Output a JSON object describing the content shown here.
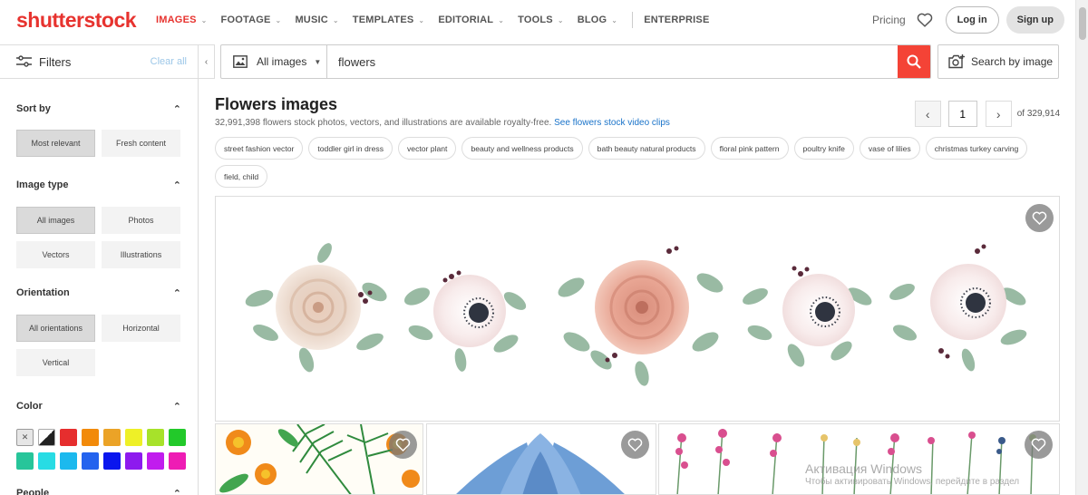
{
  "logo": "shutterstock",
  "nav": {
    "items": [
      {
        "label": "IMAGES",
        "has_menu": true,
        "active": true
      },
      {
        "label": "FOOTAGE",
        "has_menu": true
      },
      {
        "label": "MUSIC",
        "has_menu": true
      },
      {
        "label": "TEMPLATES",
        "has_menu": true
      },
      {
        "label": "EDITORIAL",
        "has_menu": true
      },
      {
        "label": "TOOLS",
        "has_menu": true
      },
      {
        "label": "BLOG",
        "has_menu": true
      }
    ],
    "enterprise": "ENTERPRISE",
    "pricing": "Pricing",
    "login": "Log in",
    "signup": "Sign up"
  },
  "sidebar": {
    "filters_label": "Filters",
    "clear_all": "Clear all",
    "sort_by": {
      "title": "Sort by",
      "options": [
        "Most relevant",
        "Fresh content"
      ],
      "selected": 0
    },
    "image_type": {
      "title": "Image type",
      "options": [
        "All images",
        "Photos",
        "Vectors",
        "Illustrations"
      ],
      "selected": 0
    },
    "orientation": {
      "title": "Orientation",
      "options": [
        "All orientations",
        "Horizontal",
        "Vertical"
      ],
      "selected": 0
    },
    "color": {
      "title": "Color",
      "swatches": [
        "none",
        "bw",
        "#e62e2e",
        "#f28a0a",
        "#eba327",
        "#eef027",
        "#a7e22a",
        "#22c92a",
        "#27c59a",
        "#28dce4",
        "#1cb9ee",
        "#2463ee",
        "#0a16ee",
        "#8d1aee",
        "#c11cee",
        "#ee1cb4"
      ]
    },
    "people": {
      "title": "People"
    }
  },
  "search": {
    "type": "All images",
    "query": "flowers",
    "search_by_image": "Search by image"
  },
  "main": {
    "title": "Flowers images",
    "subtitle": "32,991,398 flowers stock photos, vectors, and illustrations are available royalty-free.",
    "video_link": "See flowers stock video clips",
    "page": "1",
    "total_pages": "of 329,914",
    "tags": [
      "street fashion vector",
      "toddler girl in dress",
      "vector plant",
      "beauty and wellness products",
      "bath beauty natural products",
      "floral pink pattern",
      "poultry knife",
      "vase of lilies",
      "christmas turkey carving",
      "field, child"
    ]
  },
  "watermark": {
    "line1": "Активация Windows",
    "line2": "Чтобы активировать Windows, перейдите в раздел"
  }
}
